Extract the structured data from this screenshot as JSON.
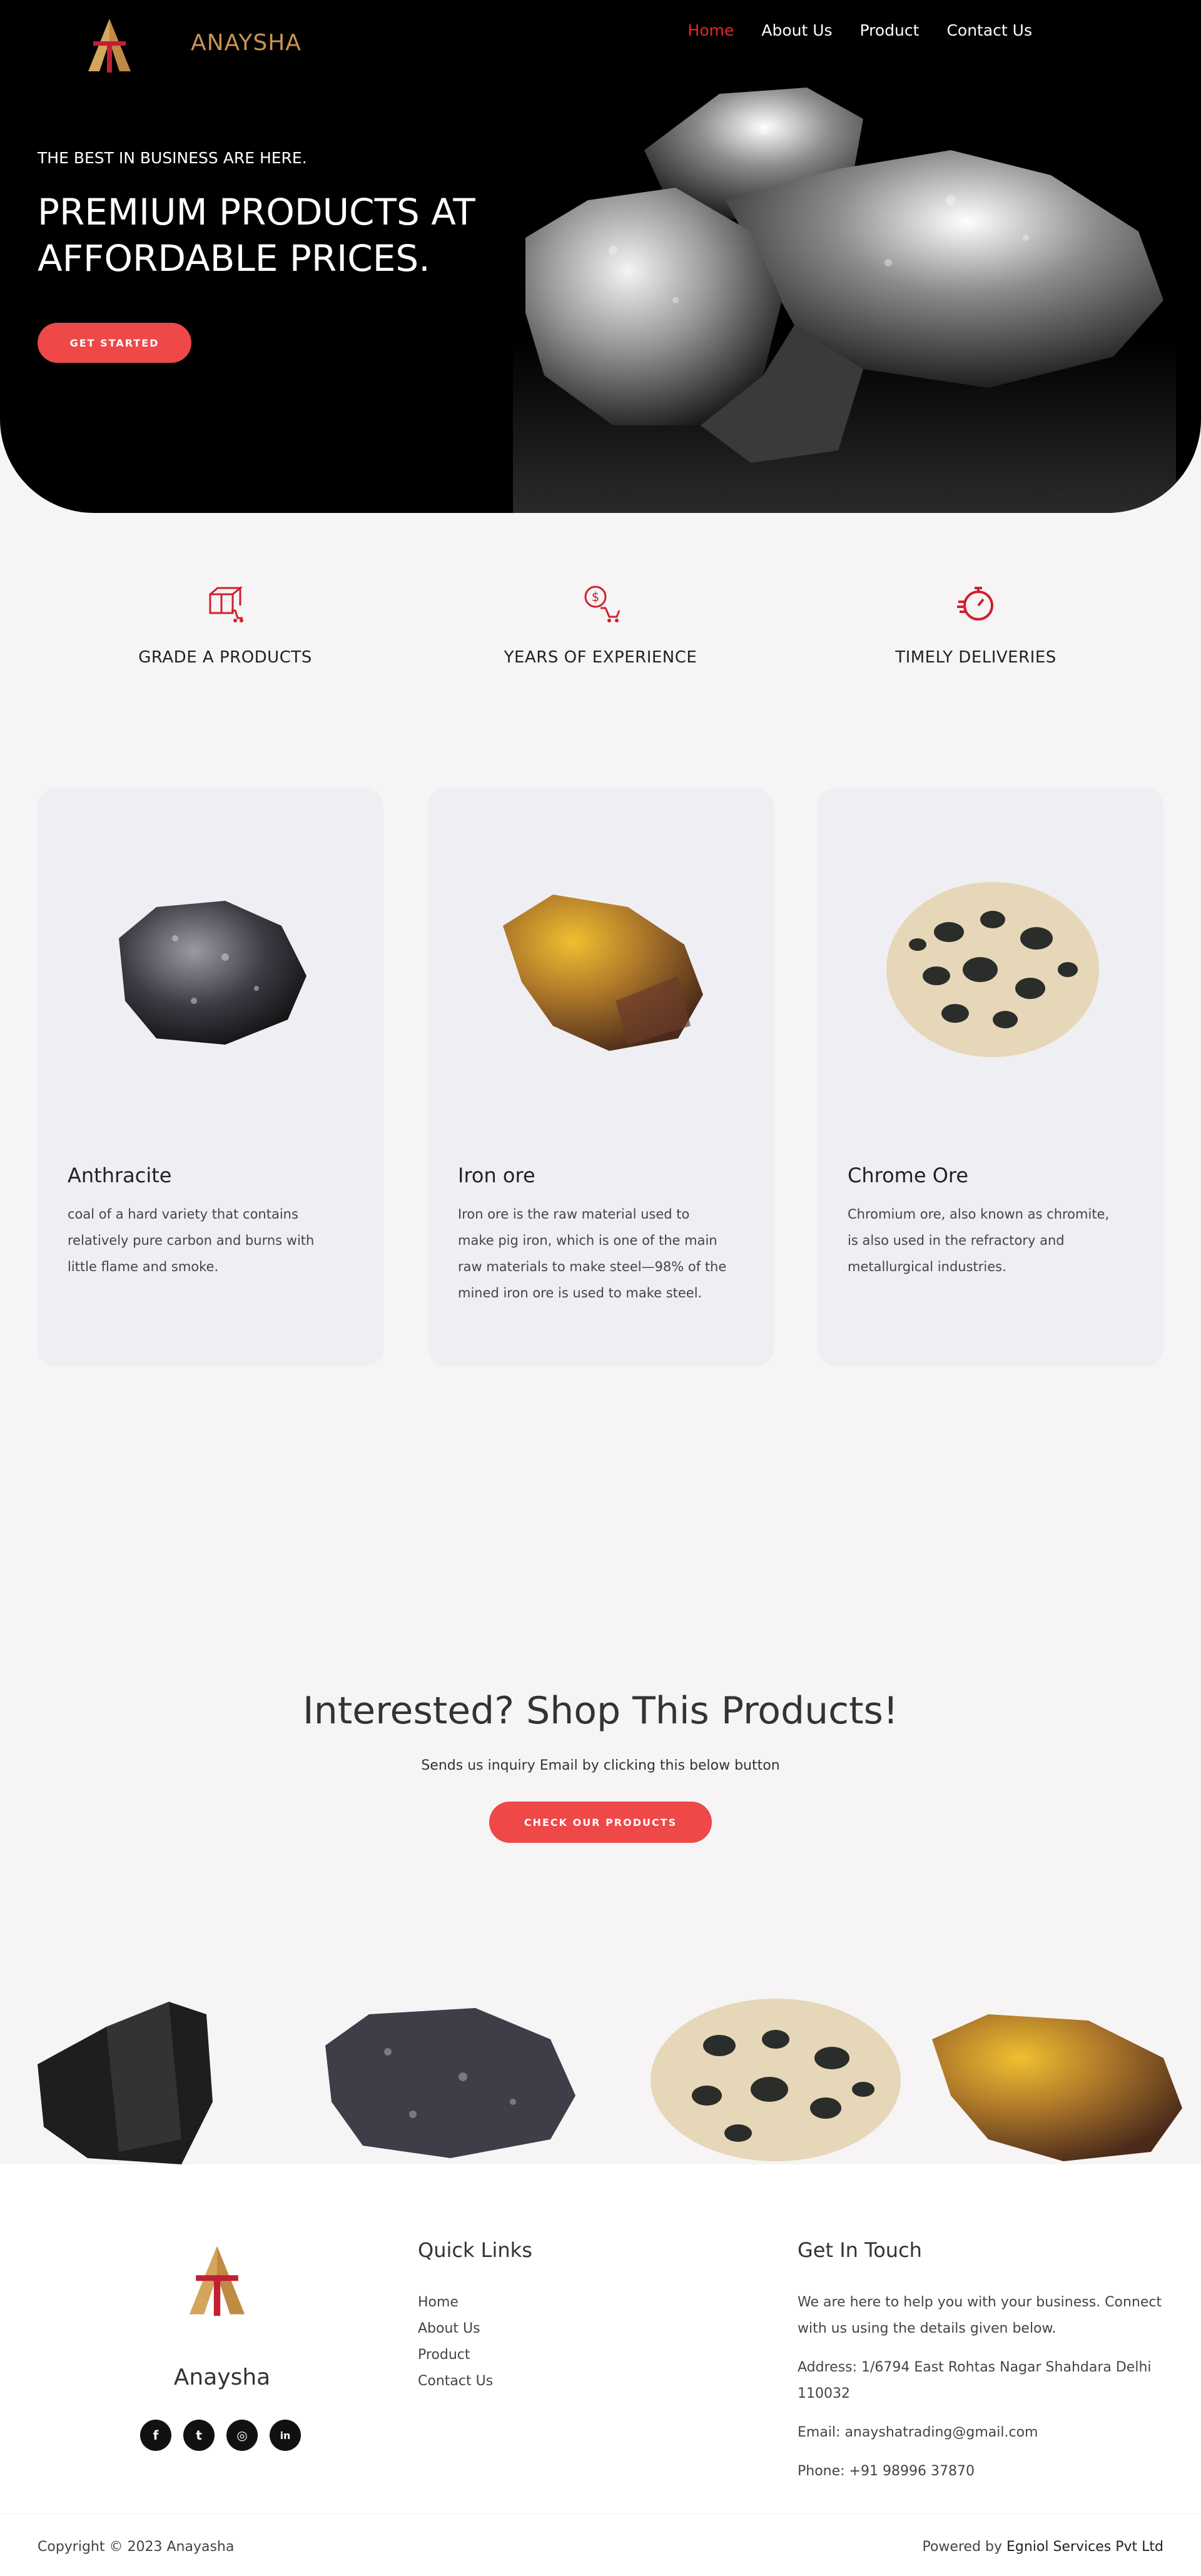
{
  "nav": {
    "brand": "ANAYSHA",
    "items": [
      {
        "label": "Home",
        "active": true
      },
      {
        "label": "About Us",
        "active": false
      },
      {
        "label": "Product",
        "active": false
      },
      {
        "label": "Contact Us",
        "active": false
      }
    ]
  },
  "hero": {
    "tagline": "THE BEST IN BUSINESS ARE HERE.",
    "headline": "PREMIUM PRODUCTS AT AFFORDABLE PRICES.",
    "cta": "GET STARTED"
  },
  "features": [
    {
      "icon": "box-cart-icon",
      "label": "GRADE A PRODUCTS"
    },
    {
      "icon": "dollar-cart-icon",
      "label": "YEARS OF EXPERIENCE"
    },
    {
      "icon": "stopwatch-icon",
      "label": "TIMELY DELIVERIES"
    }
  ],
  "products": [
    {
      "name": "Anthracite",
      "desc": "coal of a hard variety that contains relatively pure carbon and burns with little flame and smoke."
    },
    {
      "name": "Iron ore",
      "desc": "Iron ore is the raw material used to make pig iron, which is one of the main raw materials to make steel—98% of the mined iron ore is used to make steel."
    },
    {
      "name": "Chrome Ore",
      "desc": "Chromium ore, also known as chromite, is also used in the refractory and metallurgical industries."
    }
  ],
  "inquiry": {
    "title": "Interested? Shop This Products!",
    "subtitle": "Sends us inquiry Email by clicking this below button",
    "button": "CHECK OUR PRODUCTS"
  },
  "footer": {
    "brand": "Anaysha",
    "quick_links_title": "Quick Links",
    "quick_links": [
      "Home",
      "About Us",
      "Product",
      "Contact Us"
    ],
    "touch_title": "Get In Touch",
    "intro": "We are here to help you with your business. Connect with us using the details given below.",
    "address": "Address: 1/6794 East Rohtas Nagar Shahdara Delhi 110032",
    "email": "Email: anayshatrading@gmail.com",
    "phone": "Phone: +91 98996 37870",
    "social": [
      {
        "icon": "facebook-icon",
        "glyph": "f"
      },
      {
        "icon": "twitter-icon",
        "glyph": "t"
      },
      {
        "icon": "instagram-icon",
        "glyph": "◎"
      },
      {
        "icon": "linkedin-icon",
        "glyph": "in"
      }
    ],
    "copyright": "Copyright © 2023 Anayasha",
    "powered_prefix": "Powered by",
    "powered_company": "Egniol Services Pvt Ltd"
  },
  "colors": {
    "accent": "#ee4848",
    "nav_active": "#e52828",
    "brand_gold": "#c8944f",
    "hero_bg": "#000000",
    "card_bg": "#efeef3"
  }
}
